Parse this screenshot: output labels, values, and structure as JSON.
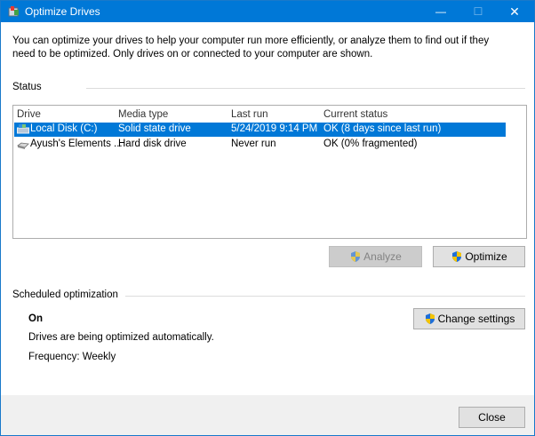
{
  "window": {
    "title": "Optimize Drives",
    "minimize_symbol": "—",
    "maximize_symbol": "☐",
    "close_symbol": "✕"
  },
  "intro_text": "You can optimize your drives to help your computer run more efficiently, or analyze them to find out if they need to be optimized. Only drives on or connected to your computer are shown.",
  "status": {
    "label": "Status",
    "columns": [
      "Drive",
      "Media type",
      "Last run",
      "Current status"
    ],
    "rows": [
      {
        "drive": "Local Disk (C:)",
        "media": "Solid state drive",
        "last_run": "5/24/2019 9:14 PM",
        "status": "OK (8 days since last run)",
        "icon": "ssd-drive-icon",
        "selected": true
      },
      {
        "drive": "Ayush's Elements ...",
        "media": "Hard disk drive",
        "last_run": "Never run",
        "status": "OK (0% fragmented)",
        "icon": "hdd-drive-icon",
        "selected": false
      }
    ]
  },
  "buttons": {
    "analyze": "Analyze",
    "optimize": "Optimize",
    "change_settings": "Change settings",
    "close": "Close"
  },
  "scheduled": {
    "label": "Scheduled optimization",
    "state": "On",
    "description": "Drives are being optimized automatically.",
    "frequency": "Frequency: Weekly"
  },
  "colors": {
    "titlebar": "#0078d7",
    "selection": "#0078d7"
  }
}
